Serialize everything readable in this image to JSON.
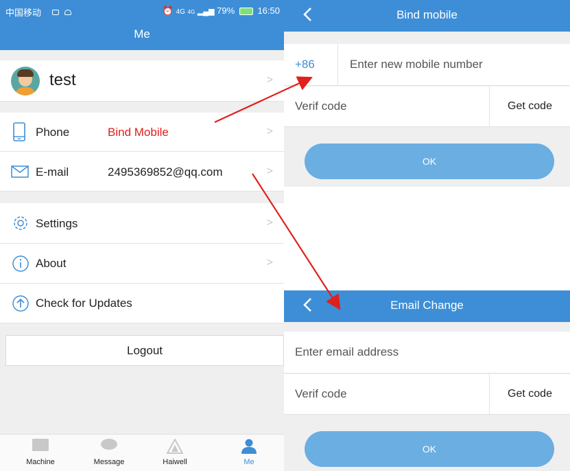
{
  "status_bar": {
    "carrier": "中国移动",
    "network": "4G",
    "network2": "4G",
    "battery": "79%",
    "time": "16:50"
  },
  "me_screen": {
    "title": "Me",
    "profile": {
      "name": "test"
    },
    "phone": {
      "label": "Phone",
      "value": "Bind Mobile",
      "value_color": "#e0201b"
    },
    "email": {
      "label": "E-mail",
      "value": "2495369852@qq.com"
    },
    "settings": {
      "label": "Settings"
    },
    "about": {
      "label": "About"
    },
    "updates": {
      "label": "Check for Updates"
    },
    "logout": "Logout",
    "tabs": [
      {
        "label": "Machine",
        "icon": "monitor-icon"
      },
      {
        "label": "Message",
        "icon": "chat-bubble-icon"
      },
      {
        "label": "Haiwell",
        "icon": "haiwell-logo-icon"
      },
      {
        "label": "Me",
        "icon": "person-icon",
        "active": true
      }
    ]
  },
  "bind_mobile": {
    "title": "Bind mobile",
    "country_code": "+86",
    "phone_placeholder": "Enter new mobile number",
    "code_placeholder": "Verif code",
    "get_code": "Get code",
    "ok": "OK"
  },
  "email_change": {
    "title": "Email Change",
    "email_placeholder": "Enter  email address",
    "code_placeholder": "Verif code",
    "get_code": "Get code",
    "ok": "OK"
  },
  "colors": {
    "header_blue": "#3d8ed6",
    "button_blue": "#6aaee2",
    "accent_red": "#e0201b",
    "arrow_red": "#e0201b"
  }
}
